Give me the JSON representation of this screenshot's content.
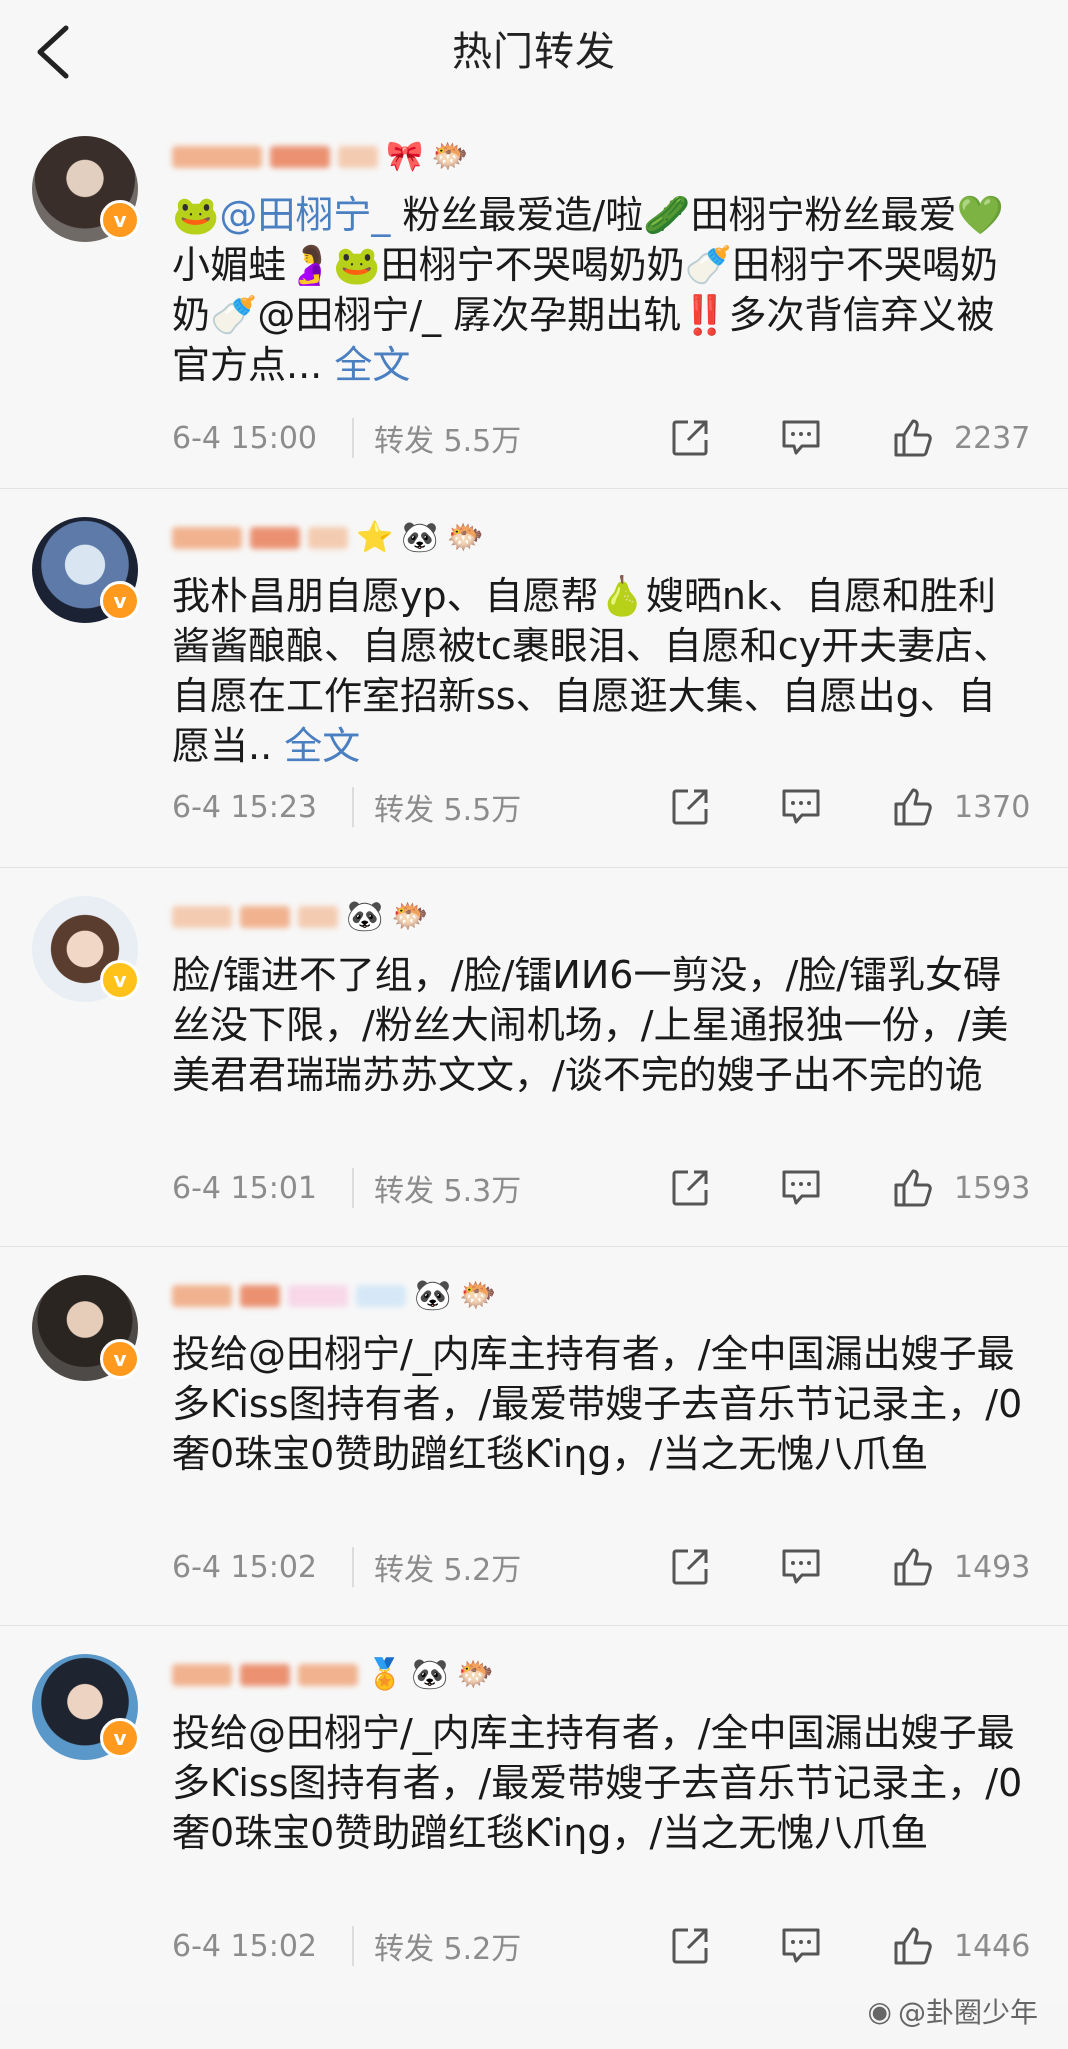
{
  "nav": {
    "title": "热门转发",
    "back_icon": "chevron-left-icon"
  },
  "posts": [
    {
      "verified": true,
      "content_prefix": "🐸",
      "mention": "@田栩宁_",
      "content": " 粉丝最爱造/啦🥒田栩宁粉丝最爱💚小媚蛙🤰🐸田栩宁不哭喝奶奶🍼田栩宁不哭喝奶奶🍼@田栩宁/_ 孱次孕期出轨‼️多次背信弃义被官方点... ",
      "full_text": "全文",
      "time": "6-4 15:00",
      "repost": "转发 5.5万",
      "likes": "2237"
    },
    {
      "verified": true,
      "content": "我朴昌朋自愿yp、自愿帮🍐嫂晒nk、自愿和胜利酱酱酿酿、自愿被tc裹眼泪、自愿和cy开夫妻店、自愿在工作室招新ss、自愿逛大集、自愿出g、自愿当.. ",
      "full_text": "全文",
      "time": "6-4 15:23",
      "repost": "转发 5.5万",
      "likes": "1370"
    },
    {
      "verified": true,
      "content": "脸/镭进不了组，/脸/镭ИИ6一剪没，/脸/镭乳女碍丝没下限，/粉丝大闹机场，/上星通报独一份，/美美君君瑞瑞苏苏文文，/谈不完的嫂子出不完的诡",
      "full_text": "",
      "time": "6-4 15:01",
      "repost": "转发 5.3万",
      "likes": "1593"
    },
    {
      "verified": true,
      "content": "投给@田栩宁/_内库主持有者，/全中国漏出嫂子最多Ƙiss图持有者，/最爱带嫂子去音乐节记录主，/0奢0珠宝0赞助蹭红毯Ƙiηg，/当之无愧八爪鱼",
      "full_text": "",
      "time": "6-4 15:02",
      "repost": "转发 5.2万",
      "likes": "1493"
    },
    {
      "verified": true,
      "content": "投给@田栩宁/_内库主持有者，/全中国漏出嫂子最多Ƙiss图持有者，/最爱带嫂子去音乐节记录主，/0奢0珠宝0赞助蹭红毯Ƙiηg，/当之无愧八爪鱼",
      "full_text": "",
      "time": "6-4 15:02",
      "repost": "转发 5.2万",
      "likes": "1446"
    }
  ],
  "watermark": "@卦圈少年",
  "colors": {
    "link": "#4a7fc1",
    "meta": "#8c8c8c",
    "badge": "#ff9a1e"
  }
}
